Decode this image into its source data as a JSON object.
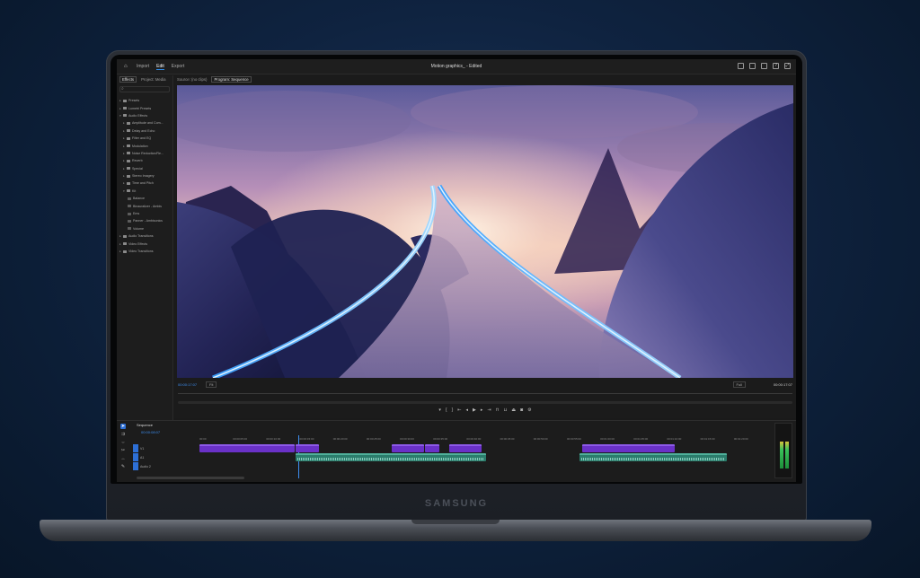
{
  "device": {
    "brand": "SAMSUNG"
  },
  "app": {
    "menus": [
      "Import",
      "Edit",
      "Export"
    ],
    "active_menu": "Edit",
    "title": "Motion graphics_ - Edited",
    "right_icons": [
      "quick-export-icon",
      "share-icon",
      "workspaces-icon",
      "help-icon",
      "fullscreen-icon"
    ]
  },
  "left_panel": {
    "tabs": [
      "Effects",
      "Project: Media"
    ],
    "active_tab": "Effects",
    "search_placeholder": "",
    "tree": [
      {
        "label": "Presets",
        "level": 0,
        "expanded": false
      },
      {
        "label": "Lumetri Presets",
        "level": 0,
        "expanded": false
      },
      {
        "label": "Audio Effects",
        "level": 0,
        "expanded": true
      },
      {
        "label": "Amplitude and Com...",
        "level": 1,
        "expanded": false
      },
      {
        "label": "Delay and Echo",
        "level": 1,
        "expanded": false
      },
      {
        "label": "Filter and EQ",
        "level": 1,
        "expanded": false
      },
      {
        "label": "Modulation",
        "level": 1,
        "expanded": false
      },
      {
        "label": "Noise Reduction/Re...",
        "level": 1,
        "expanded": false
      },
      {
        "label": "Reverb",
        "level": 1,
        "expanded": false
      },
      {
        "label": "Special",
        "level": 1,
        "expanded": false
      },
      {
        "label": "Stereo Imagery",
        "level": 1,
        "expanded": false
      },
      {
        "label": "Time and Pitch",
        "level": 1,
        "expanded": false
      },
      {
        "label": "Kit",
        "level": 1,
        "expanded": true
      },
      {
        "label": "Balance",
        "level": 2,
        "expanded": false
      },
      {
        "label": "Binauralizer - Ambis",
        "level": 2,
        "expanded": false
      },
      {
        "label": "Ems",
        "level": 2,
        "expanded": false
      },
      {
        "label": "Panner - Ambisonics",
        "level": 2,
        "expanded": false
      },
      {
        "label": "Volume",
        "level": 2,
        "expanded": false
      },
      {
        "label": "Audio Transitions",
        "level": 0,
        "expanded": false
      },
      {
        "label": "Video Effects",
        "level": 0,
        "expanded": false
      },
      {
        "label": "Video Transitions",
        "level": 0,
        "expanded": false
      }
    ]
  },
  "monitor": {
    "tabs": [
      "Source: (no clips)",
      "Program: Sequence"
    ],
    "active_tab": "Program: Sequence",
    "timecode_current": "00:00:17:07",
    "fit_label": "Fit",
    "quality_label": "Full",
    "timecode_duration": "00:00:17:07"
  },
  "timeline": {
    "sequence_tab": "Sequence",
    "timecode": "00:00:08:07",
    "ruler_labels": [
      "00:00",
      "00:00:05:00",
      "00:00:10:00",
      "00:00:15:00",
      "00:00:20:00",
      "00:00:25:00",
      "00:00:30:00",
      "00:00:35:00",
      "00:00:40:00",
      "00:00:45:00",
      "00:00:50:00",
      "00:00:55:00",
      "00:01:00:00",
      "00:01:05:00",
      "00:01:10:00",
      "00:01:15:00",
      "00:01:20:00"
    ],
    "tracks": [
      {
        "name": "V1"
      },
      {
        "name": "A1"
      },
      {
        "name": "Audio 2"
      }
    ]
  }
}
